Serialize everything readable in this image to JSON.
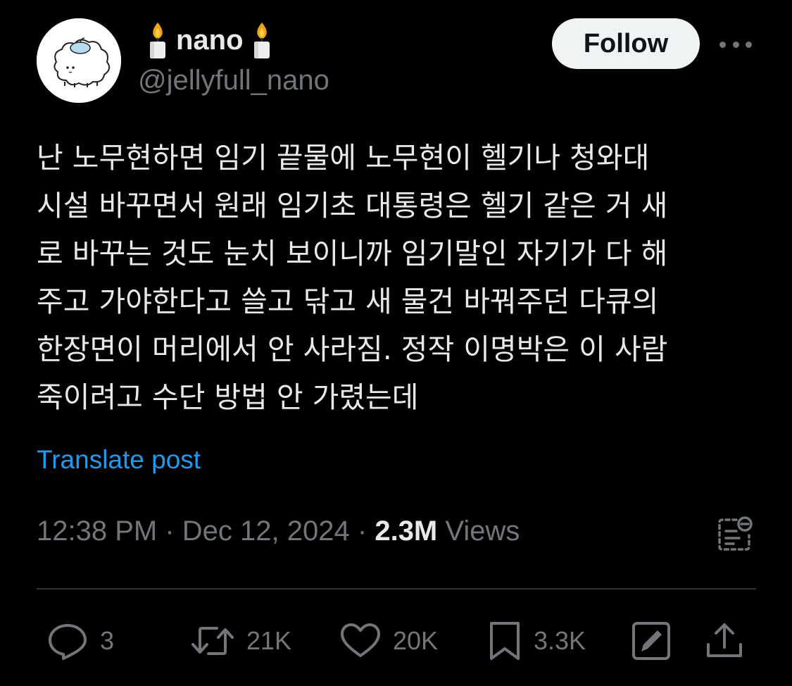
{
  "author": {
    "display_name": "nano",
    "handle": "@jellyfull_nano",
    "left_emoji": "candle-icon",
    "right_emoji": "candle-icon"
  },
  "follow_label": "Follow",
  "post": {
    "lines": [
      "난 노무현하면 임기 끝물에 노무현이 헬기나 청와대",
      "시설 바꾸면서 원래 임기초 대통령은 헬기 같은 거 새",
      "로 바꾸는 것도 눈치 보이니까 임기말인 자기가 다 해",
      "주고 가야한다고 쓸고 닦고 새 물건 바꿔주던 다큐의",
      "한장면이 머리에서 안 사라짐. 정작 이명박은 이 사람",
      "죽이려고 수단 방법 안 가렸는데"
    ],
    "translate_label": "Translate post"
  },
  "meta": {
    "time": "12:38 PM",
    "separator": "·",
    "date": "Dec 12, 2024",
    "views_count": "2.3M",
    "views_label": "Views"
  },
  "actions": {
    "replies": "3",
    "reposts": "21K",
    "likes": "20K",
    "bookmarks": "3.3K"
  },
  "colors": {
    "background": "#000000",
    "text": "#e7e9ea",
    "secondary": "#71767b",
    "link": "#1d9bf0",
    "divider": "#2f3336",
    "follow_bg": "#eff3f4"
  }
}
